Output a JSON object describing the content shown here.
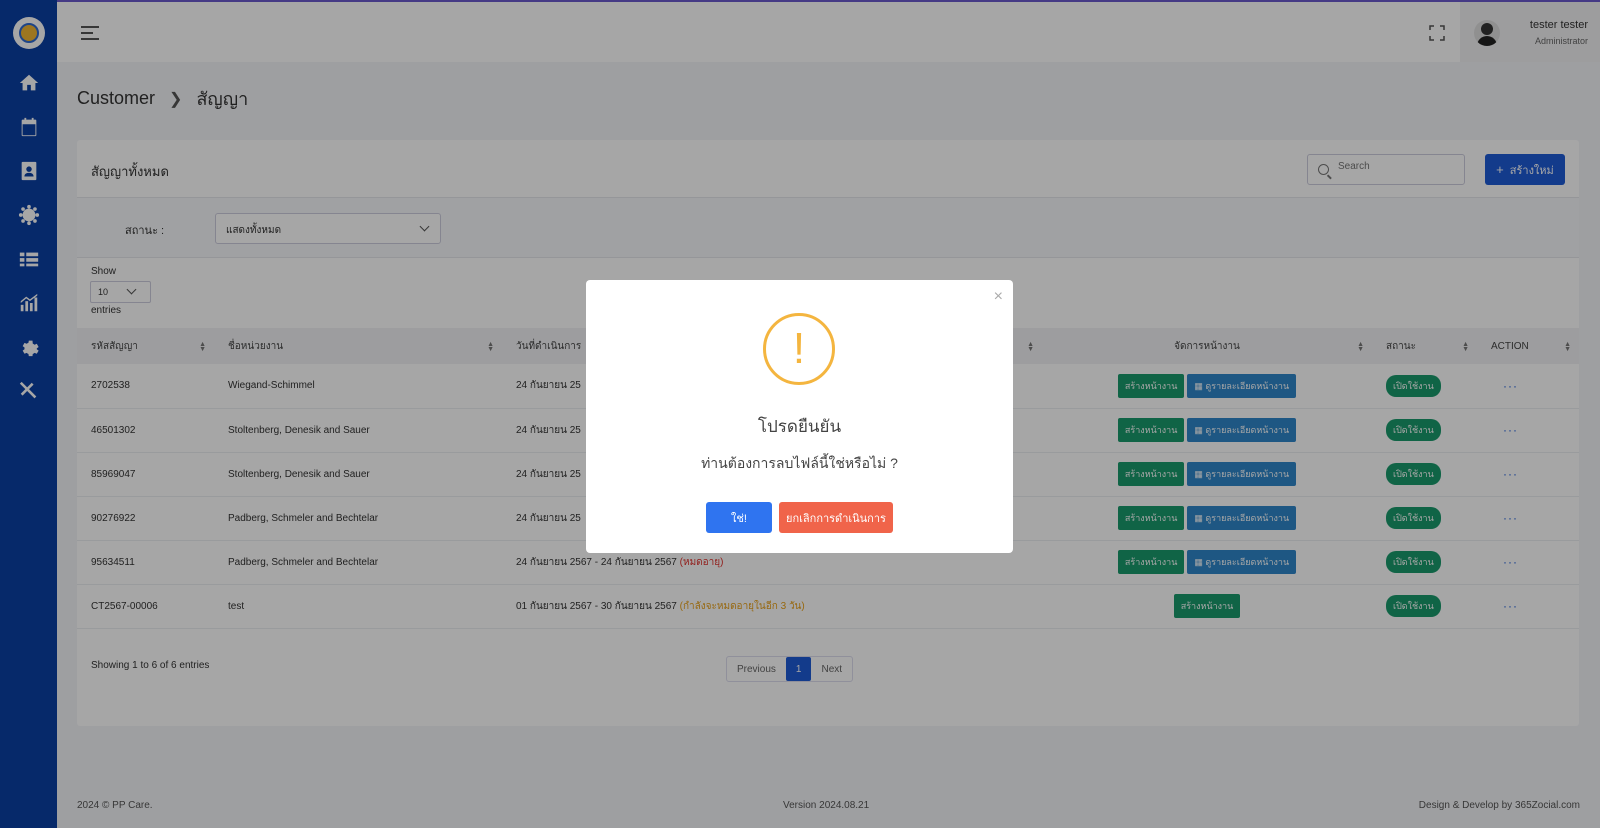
{
  "colors": {
    "sidebar": "#0a3fa3",
    "primary": "#1e5bd6",
    "success": "#1a9a6c",
    "info": "#2f86c9",
    "danger": "#f0644a",
    "warning": "#f4b53f"
  },
  "sidebar": {
    "icons": [
      "home-icon",
      "calendar-dollar-icon",
      "contact-book-icon",
      "users-gear-icon",
      "list-icon",
      "chart-icon",
      "gear-icon",
      "tools-icon"
    ]
  },
  "header": {
    "user_name": "tester tester",
    "user_role": "Administrator"
  },
  "breadcrumb": {
    "root": "Customer",
    "current": "สัญญา"
  },
  "card": {
    "title": "สัญญาทั้งหมด",
    "search_placeholder": "Search",
    "create_label": "สร้างใหม่",
    "filter_label": "สถานะ :",
    "filter_value": "แสดงทั้งหมด",
    "show_label": "Show",
    "page_length": "10",
    "entries_label": "entries"
  },
  "table": {
    "headers": [
      "รหัสสัญญา",
      "ชื่อหน่วยงาน",
      "วันที่ดำเนินการ",
      "",
      "จัดการหน้างาน",
      "สถานะ",
      "ACTION"
    ],
    "create_page_label": "สร้างหน้างาน",
    "detail_label": "ดูรายละเอียดหน้างาน",
    "rows": [
      {
        "code": "2702538",
        "org": "Wiegand-Schimmel",
        "date": "24 กันยายน 25",
        "note": "",
        "status": "เปิดใช้งาน"
      },
      {
        "code": "46501302",
        "org": "Stoltenberg, Denesik and Sauer",
        "date": "24 กันยายน 25",
        "note": "",
        "status": "เปิดใช้งาน"
      },
      {
        "code": "85969047",
        "org": "Stoltenberg, Denesik and Sauer",
        "date": "24 กันยายน 25",
        "note": "",
        "status": "เปิดใช้งาน"
      },
      {
        "code": "90276922",
        "org": "Padberg, Schmeler and Bechtelar",
        "date": "24 กันยายน 25",
        "note": "",
        "status": "เปิดใช้งาน"
      },
      {
        "code": "95634511",
        "org": "Padberg, Schmeler and Bechtelar",
        "date": "24 กันยายน 2567 - 24 กันยายน 2567",
        "note": "(หมดอายุ)",
        "status": "เปิดใช้งาน"
      },
      {
        "code": "CT2567-00006",
        "org": "test",
        "date": "01 กันยายน 2567 - 30 กันยายน 2567",
        "note": "(กำลังจะหมดอายุในอีก 3 วัน)",
        "status": "เปิดใช้งาน"
      }
    ],
    "more_label": "···"
  },
  "pagination": {
    "info": "Showing 1 to 6 of 6 entries",
    "previous": "Previous",
    "current": "1",
    "next": "Next"
  },
  "footer": {
    "copyright": "2024 © PP Care.",
    "version": "Version 2024.08.21",
    "credit": "Design & Develop by 365Zocial.com"
  },
  "modal": {
    "close": "×",
    "icon": "!",
    "title": "โปรดยืนยัน",
    "message": "ท่านต้องการลบไฟล์นี้ใช่หรือไม่ ?",
    "confirm": "ใช่!",
    "cancel": "ยกเลิกการดำเนินการ"
  }
}
